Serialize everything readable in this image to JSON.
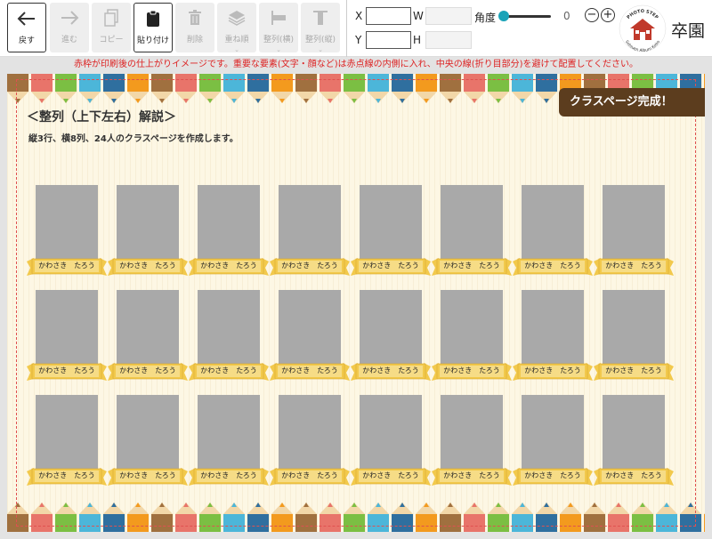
{
  "toolbar": {
    "buttons": [
      {
        "label": "戻す",
        "icon": "arrow-left-icon",
        "enabled": true
      },
      {
        "label": "進む",
        "icon": "arrow-right-icon",
        "enabled": false
      },
      {
        "label": "コピー",
        "icon": "copy-icon",
        "enabled": false
      },
      {
        "label": "貼り付け",
        "icon": "clipboard-icon",
        "enabled": true
      },
      {
        "label": "削除",
        "icon": "trash-icon",
        "enabled": false
      },
      {
        "label": "重ね順",
        "icon": "layers-icon",
        "enabled": false
      },
      {
        "label": "整列(横)",
        "icon": "align-horizontal-icon",
        "enabled": false
      },
      {
        "label": "整列(縦)",
        "icon": "align-vertical-icon",
        "enabled": false
      }
    ]
  },
  "properties": {
    "x_label": "X",
    "y_label": "Y",
    "w_label": "W",
    "h_label": "H",
    "angle_label": "角度",
    "angle_value": "0",
    "x_value": "",
    "y_value": "",
    "w_value": "",
    "h_value": ""
  },
  "logo": {
    "top_text": "PHOTO STEP",
    "bottom_text": "Sotsuen Album Kobo",
    "brand": "卒園"
  },
  "notice": "赤枠が印刷後の仕上がりイメージです。重要な要素(文字・顔など)は赤点線の内側に入れ、中央の線(折り目部分)を避けて配置してください。",
  "page": {
    "title": "＜整列（上下左右）解説＞",
    "subtitle": "縦3行、横8列、24人のクラスページを作成します。",
    "badge": "クラスページ完成！",
    "rows": 3,
    "cols": 8,
    "student_name": "かわさき　たろう"
  },
  "colors": {
    "notice": "#dd2222",
    "badge": "#5c3d1e",
    "photo": "#a9a9a9",
    "ribbon": "#f2c94c",
    "slider": "#1aa3b8",
    "pencils": [
      "#a0703f",
      "#e8746a",
      "#7bbf43",
      "#4cb6d9",
      "#2f6f9f",
      "#f39a1e"
    ]
  }
}
